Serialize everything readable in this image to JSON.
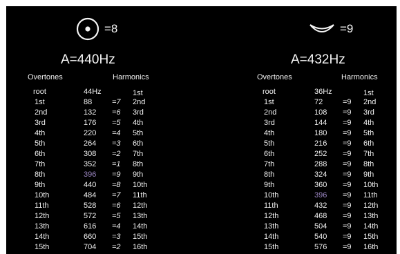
{
  "left": {
    "symbol_value": "=8",
    "frequency": "A=440Hz",
    "overtones_header": "Overtones",
    "harmonics_header": "Harmonics",
    "rows": [
      {
        "ov": "root",
        "fr": "44Hz",
        "di": "",
        "ha": "1st"
      },
      {
        "ov": "1st",
        "fr": "88",
        "di": "=7",
        "ha": "2nd"
      },
      {
        "ov": "2nd",
        "fr": "132",
        "di": "=6",
        "ha": "3rd"
      },
      {
        "ov": "3rd",
        "fr": "176",
        "di": "=5",
        "ha": "4th"
      },
      {
        "ov": "4th",
        "fr": "220",
        "di": "=4",
        "ha": "5th"
      },
      {
        "ov": "5th",
        "fr": "264",
        "di": "=3",
        "ha": "6th"
      },
      {
        "ov": "6th",
        "fr": "308",
        "di": "=2",
        "ha": "7th"
      },
      {
        "ov": "7th",
        "fr": "352",
        "di": "=1",
        "ha": "8th"
      },
      {
        "ov": "8th",
        "fr": "396",
        "di": "=9",
        "ha": "9th"
      },
      {
        "ov": "9th",
        "fr": "440",
        "di": "=8",
        "ha": "10th"
      },
      {
        "ov": "10th",
        "fr": "484",
        "di": "=7",
        "ha": "11th"
      },
      {
        "ov": "11th",
        "fr": "528",
        "di": "=6",
        "ha": "12th"
      },
      {
        "ov": "12th",
        "fr": "572",
        "di": "=5",
        "ha": "13th"
      },
      {
        "ov": "13th",
        "fr": "616",
        "di": "=4",
        "ha": "14th"
      },
      {
        "ov": "14th",
        "fr": "660",
        "di": "=3",
        "ha": "15th"
      },
      {
        "ov": "15th",
        "fr": "704",
        "di": "=2",
        "ha": "16th"
      }
    ],
    "highlight_row": 8
  },
  "right": {
    "symbol_value": "=9",
    "frequency": "A=432Hz",
    "overtones_header": "Overtones",
    "harmonics_header": "Harmonics",
    "rows": [
      {
        "ov": "root",
        "fr": "36Hz",
        "di": "",
        "ha": "1st"
      },
      {
        "ov": "1st",
        "fr": "72",
        "di": "=9",
        "ha": "2nd"
      },
      {
        "ov": "2nd",
        "fr": "108",
        "di": "=9",
        "ha": "3rd"
      },
      {
        "ov": "3rd",
        "fr": "144",
        "di": "=9",
        "ha": "4th"
      },
      {
        "ov": "4th",
        "fr": "180",
        "di": "=9",
        "ha": "5th"
      },
      {
        "ov": "5th",
        "fr": "216",
        "di": "=9",
        "ha": "6th"
      },
      {
        "ov": "6th",
        "fr": "252",
        "di": "=9",
        "ha": "7th"
      },
      {
        "ov": "7th",
        "fr": "288",
        "di": "=9",
        "ha": "8th"
      },
      {
        "ov": "8th",
        "fr": "324",
        "di": "=9",
        "ha": "9th"
      },
      {
        "ov": "9th",
        "fr": "360",
        "di": "=9",
        "ha": "10th"
      },
      {
        "ov": "10th",
        "fr": "396",
        "di": "=9",
        "ha": "11th"
      },
      {
        "ov": "11th",
        "fr": "432",
        "di": "=9",
        "ha": "12th"
      },
      {
        "ov": "12th",
        "fr": "468",
        "di": "=9",
        "ha": "13th"
      },
      {
        "ov": "13th",
        "fr": "504",
        "di": "=9",
        "ha": "14th"
      },
      {
        "ov": "14th",
        "fr": "540",
        "di": "=9",
        "ha": "15th"
      },
      {
        "ov": "15th",
        "fr": "576",
        "di": "=9",
        "ha": "16th"
      }
    ],
    "highlight_row": 10
  },
  "colors": {
    "background": "#000000",
    "text": "#f0f0f0",
    "highlight": "#9a85c0"
  },
  "icons": {
    "left": "circumpunct-icon",
    "right": "crescent-icon"
  }
}
